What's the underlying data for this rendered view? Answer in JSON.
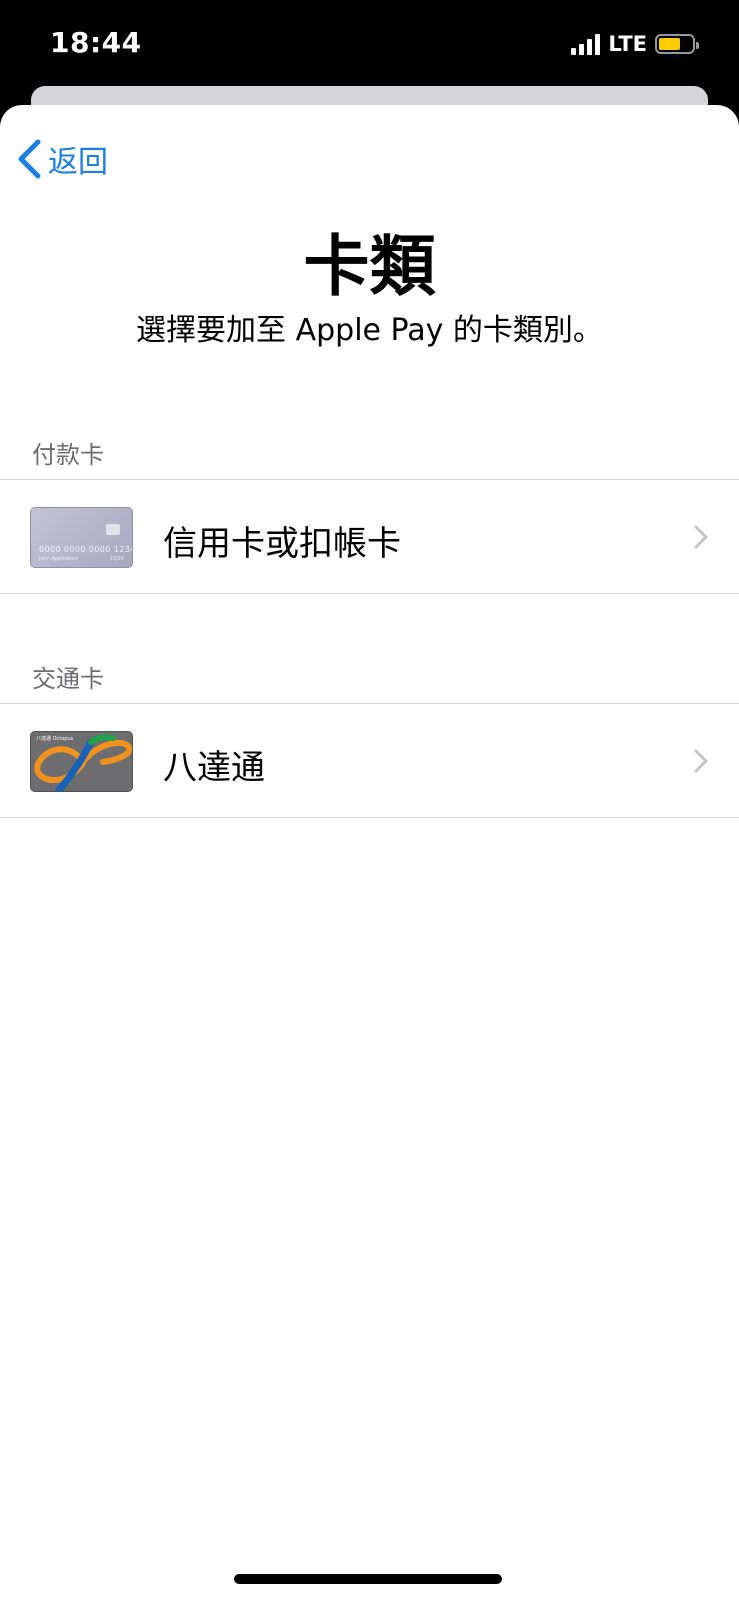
{
  "status_bar": {
    "time": "18:44",
    "network": "LTE",
    "battery_level": 0.65,
    "battery_color": "#ffcc00"
  },
  "nav": {
    "back_label": "返回"
  },
  "header": {
    "title": "卡類",
    "subtitle": "選擇要加至 Apple Pay 的卡類別。"
  },
  "sections": {
    "payment": {
      "header": "付款卡",
      "item": {
        "label": "信用卡或扣帳卡",
        "card_number": "0000 0000 0000 1234",
        "card_holder": "John Appleseed",
        "card_expiry": "10/20"
      }
    },
    "transit": {
      "header": "交通卡",
      "item": {
        "label": "八達通",
        "card_brand": "八達通 Octopus"
      }
    }
  },
  "colors": {
    "accent": "#1b7fe3",
    "section_header": "#6d6d72",
    "separator": "#d6d6d8"
  }
}
